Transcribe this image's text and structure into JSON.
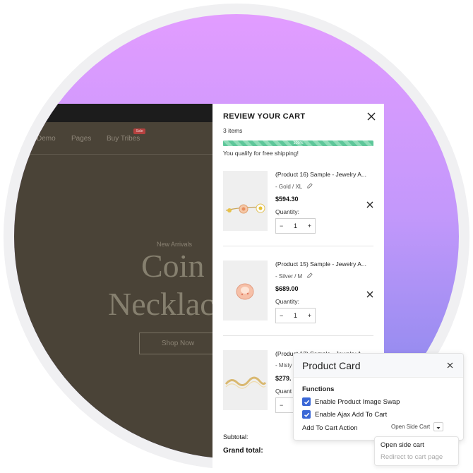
{
  "store": {
    "nav": [
      "Demo",
      "Pages",
      "Buy Tribes"
    ],
    "sale_badge": "Sale",
    "kicker": "New Arrivals",
    "hero_line1": "Coin",
    "hero_line2": "Necklac",
    "shop_button": "Shop Now"
  },
  "cart": {
    "title": "REVIEW YOUR CART",
    "count": "3 items",
    "progress": {
      "value": 1.0,
      "label": "100%",
      "color": "#5ec79a"
    },
    "shipping_message": "You qualify for free shipping!",
    "quantity_label": "Quantity:",
    "items": [
      {
        "name": "(Product 16) Sample - Jewelry A...",
        "variant": "- Gold / XL",
        "price": "$594.30",
        "qty": "1",
        "image": "gold-flower-bracelet"
      },
      {
        "name": "(Product 15) Sample - Jewelry A...",
        "variant": "- Silver / M",
        "price": "$689.00",
        "qty": "1",
        "image": "rose-gold-ring"
      },
      {
        "name": "(Product 13) Sample - Jewelry A...",
        "variant": "- Misty",
        "price": "$279.",
        "qty": "",
        "image": "gold-wave-bangle"
      }
    ],
    "item3_qty_label": "Quant",
    "subtotal_label": "Subtotal:",
    "grand_total_label": "Grand total:"
  },
  "product_card": {
    "title": "Product Card",
    "section": "Functions",
    "options": [
      {
        "label": "Enable Product Image Swap",
        "checked": true
      },
      {
        "label": "Enable Ajax Add To Cart",
        "checked": true
      }
    ],
    "action_label": "Add To Cart Action",
    "action_value": "Open Side Cart",
    "dropdown_options": [
      "Open side cart",
      "Redirect to cart page"
    ],
    "accent": "#3a67d6"
  }
}
